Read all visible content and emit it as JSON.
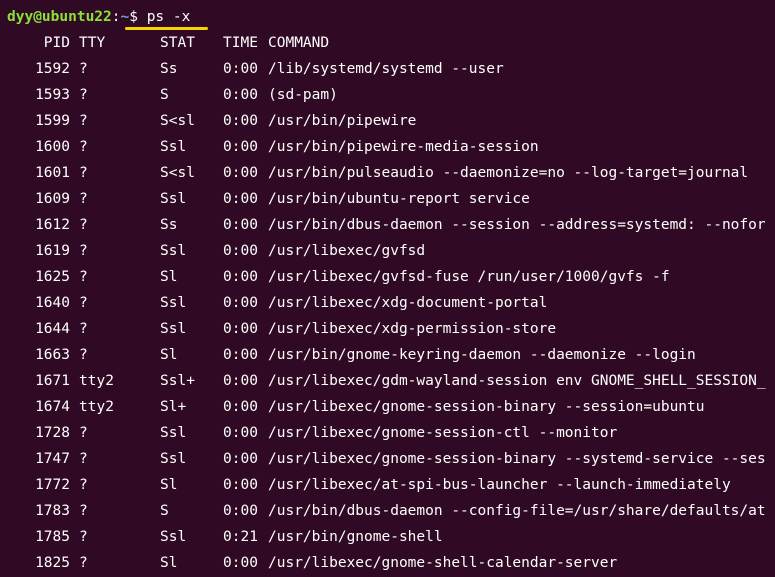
{
  "prompt": {
    "user_host": "dyy@ubuntu22",
    "colon": ":",
    "path": "~",
    "dollar": "$",
    "command": "ps -x"
  },
  "colors": {
    "background": "#300a24",
    "prompt_user": "#8ae234",
    "prompt_path": "#729fcf",
    "text": "#ffffff",
    "underline": "#f5d300"
  },
  "headers": {
    "pid": "PID",
    "tty": "TTY",
    "stat": "STAT",
    "time": "TIME",
    "command": "COMMAND"
  },
  "processes": [
    {
      "pid": "1592",
      "tty": "?",
      "stat": "Ss",
      "time": "0:00",
      "command": "/lib/systemd/systemd --user"
    },
    {
      "pid": "1593",
      "tty": "?",
      "stat": "S",
      "time": "0:00",
      "command": "(sd-pam)"
    },
    {
      "pid": "1599",
      "tty": "?",
      "stat": "S<sl",
      "time": "0:00",
      "command": "/usr/bin/pipewire"
    },
    {
      "pid": "1600",
      "tty": "?",
      "stat": "Ssl",
      "time": "0:00",
      "command": "/usr/bin/pipewire-media-session"
    },
    {
      "pid": "1601",
      "tty": "?",
      "stat": "S<sl",
      "time": "0:00",
      "command": "/usr/bin/pulseaudio --daemonize=no --log-target=journal"
    },
    {
      "pid": "1609",
      "tty": "?",
      "stat": "Ssl",
      "time": "0:00",
      "command": "/usr/bin/ubuntu-report service"
    },
    {
      "pid": "1612",
      "tty": "?",
      "stat": "Ss",
      "time": "0:00",
      "command": "/usr/bin/dbus-daemon --session --address=systemd: --nofor"
    },
    {
      "pid": "1619",
      "tty": "?",
      "stat": "Ssl",
      "time": "0:00",
      "command": "/usr/libexec/gvfsd"
    },
    {
      "pid": "1625",
      "tty": "?",
      "stat": "Sl",
      "time": "0:00",
      "command": "/usr/libexec/gvfsd-fuse /run/user/1000/gvfs -f"
    },
    {
      "pid": "1640",
      "tty": "?",
      "stat": "Ssl",
      "time": "0:00",
      "command": "/usr/libexec/xdg-document-portal"
    },
    {
      "pid": "1644",
      "tty": "?",
      "stat": "Ssl",
      "time": "0:00",
      "command": "/usr/libexec/xdg-permission-store"
    },
    {
      "pid": "1663",
      "tty": "?",
      "stat": "Sl",
      "time": "0:00",
      "command": "/usr/bin/gnome-keyring-daemon --daemonize --login"
    },
    {
      "pid": "1671",
      "tty": "tty2",
      "stat": "Ssl+",
      "time": "0:00",
      "command": "/usr/libexec/gdm-wayland-session env GNOME_SHELL_SESSION_"
    },
    {
      "pid": "1674",
      "tty": "tty2",
      "stat": "Sl+",
      "time": "0:00",
      "command": "/usr/libexec/gnome-session-binary --session=ubuntu"
    },
    {
      "pid": "1728",
      "tty": "?",
      "stat": "Ssl",
      "time": "0:00",
      "command": "/usr/libexec/gnome-session-ctl --monitor"
    },
    {
      "pid": "1747",
      "tty": "?",
      "stat": "Ssl",
      "time": "0:00",
      "command": "/usr/libexec/gnome-session-binary --systemd-service --ses"
    },
    {
      "pid": "1772",
      "tty": "?",
      "stat": "Sl",
      "time": "0:00",
      "command": "/usr/libexec/at-spi-bus-launcher --launch-immediately"
    },
    {
      "pid": "1783",
      "tty": "?",
      "stat": "S",
      "time": "0:00",
      "command": "/usr/bin/dbus-daemon --config-file=/usr/share/defaults/at"
    },
    {
      "pid": "1785",
      "tty": "?",
      "stat": "Ssl",
      "time": "0:21",
      "command": "/usr/bin/gnome-shell"
    },
    {
      "pid": "1825",
      "tty": "?",
      "stat": "Sl",
      "time": "0:00",
      "command": "/usr/libexec/gnome-shell-calendar-server"
    }
  ]
}
